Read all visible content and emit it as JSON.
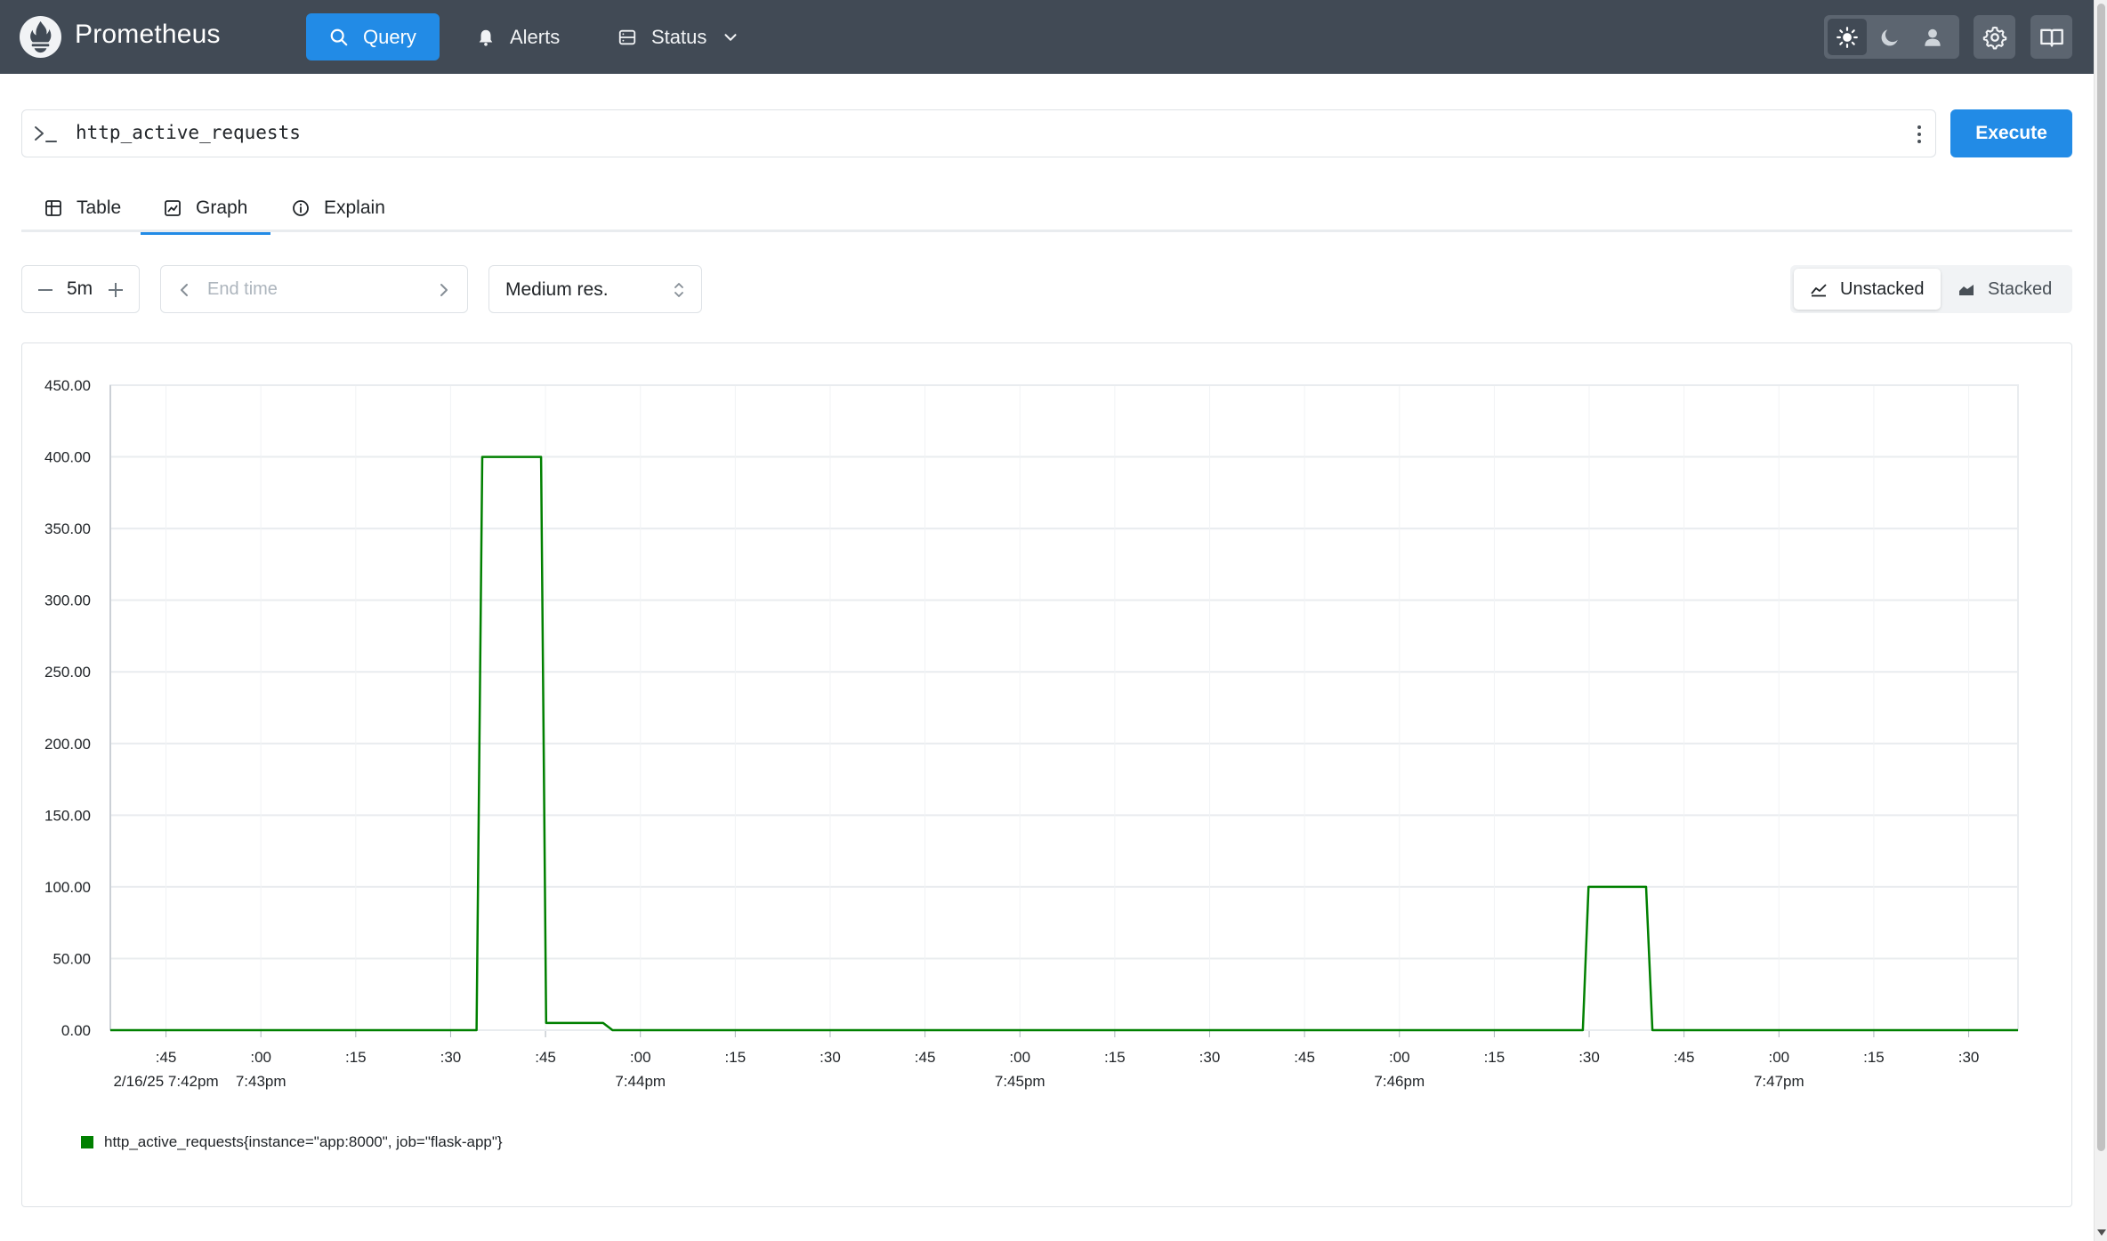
{
  "header": {
    "brand": "Prometheus",
    "nav": [
      {
        "label": "Query",
        "icon": "search-icon",
        "active": true
      },
      {
        "label": "Alerts",
        "icon": "bell-icon"
      },
      {
        "label": "Status",
        "icon": "server-icon",
        "dropdown": true
      }
    ],
    "theme_modes": [
      "sun-icon",
      "moon-icon",
      "user-icon"
    ],
    "theme_active": "light",
    "actions": [
      "gear-icon",
      "book-icon"
    ]
  },
  "query": {
    "expression": "http_active_requests",
    "execute_label": "Execute"
  },
  "tabs": [
    {
      "label": "Table",
      "icon": "table-icon"
    },
    {
      "label": "Graph",
      "icon": "graph-icon",
      "active": true
    },
    {
      "label": "Explain",
      "icon": "info-icon"
    }
  ],
  "controls": {
    "range": "5m",
    "end_time_placeholder": "End time",
    "resolution": "Medium res.",
    "unstacked_label": "Unstacked",
    "stacked_label": "Stacked",
    "stack_mode": "unstacked"
  },
  "colors": {
    "header_bg": "#414a55",
    "accent": "#228be6",
    "series": "#008000"
  },
  "chart_data": {
    "type": "line",
    "ylim": [
      0,
      450
    ],
    "yticks": [
      "450.00",
      "400.00",
      "350.00",
      "300.00",
      "250.00",
      "200.00",
      "150.00",
      "100.00",
      "50.00",
      "0.00"
    ],
    "xlim": [
      "7:42:30pm",
      "7:47:38pm"
    ],
    "xticks": [
      {
        "t": 45,
        "label": ":45",
        "sub": "2/16/25 7:42pm"
      },
      {
        "t": 60,
        "label": ":00",
        "sub": "7:43pm"
      },
      {
        "t": 75,
        "label": ":15"
      },
      {
        "t": 90,
        "label": ":30"
      },
      {
        "t": 105,
        "label": ":45"
      },
      {
        "t": 120,
        "label": ":00",
        "sub": "7:44pm"
      },
      {
        "t": 135,
        "label": ":15"
      },
      {
        "t": 150,
        "label": ":30"
      },
      {
        "t": 165,
        "label": ":45"
      },
      {
        "t": 180,
        "label": ":00",
        "sub": "7:45pm"
      },
      {
        "t": 195,
        "label": ":15"
      },
      {
        "t": 210,
        "label": ":30"
      },
      {
        "t": 225,
        "label": ":45"
      },
      {
        "t": 240,
        "label": ":00",
        "sub": "7:46pm"
      },
      {
        "t": 255,
        "label": ":15"
      },
      {
        "t": 270,
        "label": ":30"
      },
      {
        "t": 285,
        "label": ":45"
      },
      {
        "t": 300,
        "label": ":00",
        "sub": "7:47pm"
      },
      {
        "t": 315,
        "label": ":15"
      },
      {
        "t": 330,
        "label": ":30"
      }
    ],
    "grid": true,
    "series": [
      {
        "name": "http_active_requests{instance=\"app:8000\", job=\"flask-app\"}",
        "color": "#008000",
        "points": [
          [
            36.2,
            0
          ],
          [
            94.1,
            0
          ],
          [
            95.0,
            400
          ],
          [
            104.3,
            400
          ],
          [
            105.1,
            5
          ],
          [
            114.1,
            5
          ],
          [
            115.6,
            0
          ],
          [
            269.0,
            0
          ],
          [
            269.9,
            100
          ],
          [
            279.0,
            100
          ],
          [
            280.0,
            0
          ],
          [
            337.8,
            0
          ]
        ]
      }
    ]
  }
}
